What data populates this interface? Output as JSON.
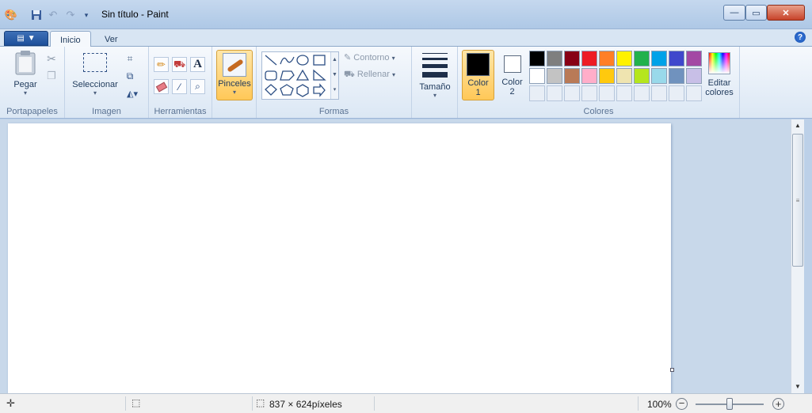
{
  "window": {
    "title": "Sin título - Paint"
  },
  "tabs": {
    "home": "Inicio",
    "view": "Ver"
  },
  "clipboard": {
    "paste": "Pegar",
    "group": "Portapapeles"
  },
  "image": {
    "select": "Seleccionar",
    "group": "Imagen"
  },
  "tools": {
    "group": "Herramientas",
    "text_glyph": "A"
  },
  "brushes": {
    "label": "Pinceles"
  },
  "shapes": {
    "outline": "Contorno",
    "fill": "Rellenar",
    "group": "Formas"
  },
  "size": {
    "label": "Tamaño"
  },
  "colors": {
    "color1": "Color 1",
    "color1_line1": "Color",
    "color1_line2": "1",
    "color2": "Color 2",
    "color2_line1": "Color",
    "color2_line2": "2",
    "edit_line1": "Editar",
    "edit_line2": "colores",
    "group": "Colores",
    "row1": [
      "#000000",
      "#7f7f7f",
      "#880015",
      "#ed1c24",
      "#ff7f27",
      "#fff200",
      "#22b14c",
      "#00a2e8",
      "#3f48cc",
      "#a349a4"
    ],
    "row2": [
      "#ffffff",
      "#c3c3c3",
      "#b97a57",
      "#ffaec9",
      "#ffc90e",
      "#efe4b0",
      "#b5e61d",
      "#99d9ea",
      "#7092be",
      "#c8bfe7"
    ],
    "active1": "#000000",
    "active2": "#ffffff"
  },
  "status": {
    "canvas_size": "837 × 624píxeles",
    "zoom": "100%"
  }
}
